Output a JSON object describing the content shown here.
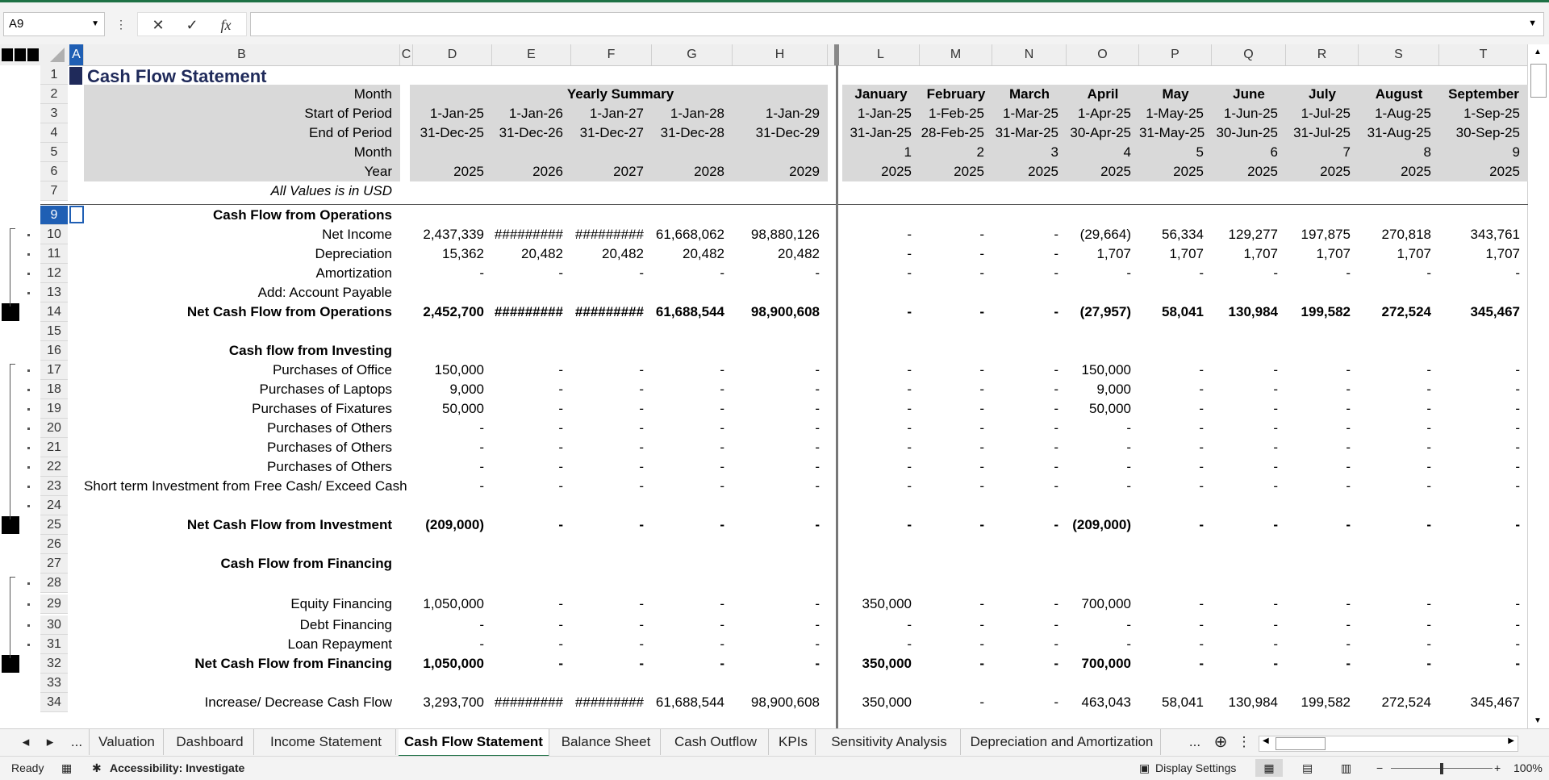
{
  "formula_bar": {
    "name_box": "A9",
    "cancel_icon": "✕",
    "enter_icon": "✓",
    "fx_label": "fx",
    "formula": ""
  },
  "columns": [
    {
      "id": "A",
      "label": "A"
    },
    {
      "id": "B",
      "label": "B"
    },
    {
      "id": "C",
      "label": "C"
    },
    {
      "id": "D",
      "label": "D"
    },
    {
      "id": "E",
      "label": "E"
    },
    {
      "id": "F",
      "label": "F"
    },
    {
      "id": "G",
      "label": "G"
    },
    {
      "id": "H",
      "label": "H"
    },
    {
      "id": "L",
      "label": "L"
    },
    {
      "id": "M",
      "label": "M"
    },
    {
      "id": "N",
      "label": "N"
    },
    {
      "id": "O",
      "label": "O"
    },
    {
      "id": "P",
      "label": "P"
    },
    {
      "id": "Q",
      "label": "Q"
    },
    {
      "id": "R",
      "label": "R"
    },
    {
      "id": "S",
      "label": "S"
    },
    {
      "id": "T",
      "label": "T"
    }
  ],
  "header": {
    "title": "Cash Flow Statement",
    "yearly_summary": "Yearly Summary",
    "all_values": "All Values is in USD",
    "labels": [
      "Month",
      "Start of Period",
      "End of Period",
      "Month",
      "Year"
    ],
    "yearly": {
      "start": [
        "1-Jan-25",
        "1-Jan-26",
        "1-Jan-27",
        "1-Jan-28",
        "1-Jan-29"
      ],
      "end": [
        "31-Dec-25",
        "31-Dec-26",
        "31-Dec-27",
        "31-Dec-28",
        "31-Dec-29"
      ],
      "year": [
        "2025",
        "2026",
        "2027",
        "2028",
        "2029"
      ]
    },
    "monthly": {
      "month": [
        "January",
        "February",
        "March",
        "April",
        "May",
        "June",
        "July",
        "August",
        "September"
      ],
      "start": [
        "1-Jan-25",
        "1-Feb-25",
        "1-Mar-25",
        "1-Apr-25",
        "1-May-25",
        "1-Jun-25",
        "1-Jul-25",
        "1-Aug-25",
        "1-Sep-25"
      ],
      "end": [
        "31-Jan-25",
        "28-Feb-25",
        "31-Mar-25",
        "30-Apr-25",
        "31-May-25",
        "30-Jun-25",
        "31-Jul-25",
        "31-Aug-25",
        "30-Sep-25"
      ],
      "num": [
        "1",
        "2",
        "3",
        "4",
        "5",
        "6",
        "7",
        "8",
        "9"
      ],
      "year": [
        "2025",
        "2025",
        "2025",
        "2025",
        "2025",
        "2025",
        "2025",
        "2025",
        "2025"
      ]
    }
  },
  "body_rows": [
    {
      "n": "9",
      "label": "Cash Flow from Operations",
      "bold": true,
      "yearly": [
        "",
        "",
        "",
        "",
        ""
      ],
      "monthly": [
        "",
        "",
        "",
        "",
        "",
        "",
        "",
        "",
        ""
      ]
    },
    {
      "n": "10",
      "label": "Net Income",
      "bold": false,
      "yearly": [
        "2,437,339",
        "#########",
        "#########",
        "61,668,062",
        "98,880,126"
      ],
      "monthly": [
        "-",
        "-",
        "-",
        "(29,664)",
        "56,334",
        "129,277",
        "197,875",
        "270,818",
        "343,761"
      ]
    },
    {
      "n": "11",
      "label": "Depreciation",
      "bold": false,
      "yearly": [
        "15,362",
        "20,482",
        "20,482",
        "20,482",
        "20,482"
      ],
      "monthly": [
        "-",
        "-",
        "-",
        "1,707",
        "1,707",
        "1,707",
        "1,707",
        "1,707",
        "1,707"
      ]
    },
    {
      "n": "12",
      "label": "Amortization",
      "bold": false,
      "yearly": [
        "-",
        "-",
        "-",
        "-",
        "-"
      ],
      "monthly": [
        "-",
        "-",
        "-",
        "-",
        "-",
        "-",
        "-",
        "-",
        "-"
      ]
    },
    {
      "n": "13",
      "label": "Add: Account Payable",
      "bold": false,
      "yearly": [
        "",
        "",
        "",
        "",
        ""
      ],
      "monthly": [
        "",
        "",
        "",
        "",
        "",
        "",
        "",
        "",
        ""
      ]
    },
    {
      "n": "14",
      "label": "Net Cash Flow from Operations",
      "bold": true,
      "yearly": [
        "2,452,700",
        "#########",
        "#########",
        "61,688,544",
        "98,900,608"
      ],
      "monthly": [
        "-",
        "-",
        "-",
        "(27,957)",
        "58,041",
        "130,984",
        "199,582",
        "272,524",
        "345,467"
      ]
    },
    {
      "n": "15",
      "label": "",
      "bold": false,
      "yearly": [
        "",
        "",
        "",
        "",
        ""
      ],
      "monthly": [
        "",
        "",
        "",
        "",
        "",
        "",
        "",
        "",
        ""
      ]
    },
    {
      "n": "16",
      "label": "Cash flow from Investing",
      "bold": true,
      "yearly": [
        "",
        "",
        "",
        "",
        ""
      ],
      "monthly": [
        "",
        "",
        "",
        "",
        "",
        "",
        "",
        "",
        ""
      ]
    },
    {
      "n": "17",
      "label": "Purchases of Office",
      "bold": false,
      "yearly": [
        "150,000",
        "-",
        "-",
        "-",
        "-"
      ],
      "monthly": [
        "-",
        "-",
        "-",
        "150,000",
        "-",
        "-",
        "-",
        "-",
        "-"
      ]
    },
    {
      "n": "18",
      "label": "Purchases of Laptops",
      "bold": false,
      "yearly": [
        "9,000",
        "-",
        "-",
        "-",
        "-"
      ],
      "monthly": [
        "-",
        "-",
        "-",
        "9,000",
        "-",
        "-",
        "-",
        "-",
        "-"
      ]
    },
    {
      "n": "19",
      "label": "Purchases of Fixatures",
      "bold": false,
      "yearly": [
        "50,000",
        "-",
        "-",
        "-",
        "-"
      ],
      "monthly": [
        "-",
        "-",
        "-",
        "50,000",
        "-",
        "-",
        "-",
        "-",
        "-"
      ]
    },
    {
      "n": "20",
      "label": "Purchases of Others",
      "bold": false,
      "yearly": [
        "-",
        "-",
        "-",
        "-",
        "-"
      ],
      "monthly": [
        "-",
        "-",
        "-",
        "-",
        "-",
        "-",
        "-",
        "-",
        "-"
      ]
    },
    {
      "n": "21",
      "label": "Purchases of Others",
      "bold": false,
      "yearly": [
        "-",
        "-",
        "-",
        "-",
        "-"
      ],
      "monthly": [
        "-",
        "-",
        "-",
        "-",
        "-",
        "-",
        "-",
        "-",
        "-"
      ]
    },
    {
      "n": "22",
      "label": "Purchases of Others",
      "bold": false,
      "yearly": [
        "-",
        "-",
        "-",
        "-",
        "-"
      ],
      "monthly": [
        "-",
        "-",
        "-",
        "-",
        "-",
        "-",
        "-",
        "-",
        "-"
      ]
    },
    {
      "n": "23",
      "label": "Short term Investment from Free Cash/ Exceed Cash",
      "bold": false,
      "yearly": [
        "-",
        "-",
        "-",
        "-",
        "-"
      ],
      "monthly": [
        "-",
        "-",
        "-",
        "-",
        "-",
        "-",
        "-",
        "-",
        "-"
      ]
    },
    {
      "n": "24",
      "label": "",
      "bold": false,
      "yearly": [
        "",
        "",
        "",
        "",
        ""
      ],
      "monthly": [
        "",
        "",
        "",
        "",
        "",
        "",
        "",
        "",
        ""
      ]
    },
    {
      "n": "25",
      "label": "Net Cash Flow from Investment",
      "bold": true,
      "yearly": [
        "(209,000)",
        "-",
        "-",
        "-",
        "-"
      ],
      "monthly": [
        "-",
        "-",
        "-",
        "(209,000)",
        "-",
        "-",
        "-",
        "-",
        "-"
      ]
    },
    {
      "n": "26",
      "label": "",
      "bold": false,
      "yearly": [
        "",
        "",
        "",
        "",
        ""
      ],
      "monthly": [
        "",
        "",
        "",
        "",
        "",
        "",
        "",
        "",
        ""
      ]
    },
    {
      "n": "27",
      "label": "Cash Flow from Financing",
      "bold": true,
      "yearly": [
        "",
        "",
        "",
        "",
        ""
      ],
      "monthly": [
        "",
        "",
        "",
        "",
        "",
        "",
        "",
        "",
        ""
      ]
    },
    {
      "n": "28",
      "label": "",
      "bold": false,
      "yearly": [
        "",
        "",
        "",
        "",
        ""
      ],
      "monthly": [
        "",
        "",
        "",
        "",
        "",
        "",
        "",
        "",
        ""
      ]
    },
    {
      "n": "29",
      "label": "Equity Financing",
      "bold": false,
      "yearly": [
        "1,050,000",
        "-",
        "-",
        "-",
        "-"
      ],
      "monthly": [
        "350,000",
        "-",
        "-",
        "700,000",
        "-",
        "-",
        "-",
        "-",
        "-"
      ]
    },
    {
      "n": "30",
      "label": "Debt Financing",
      "bold": false,
      "yearly": [
        "-",
        "-",
        "-",
        "-",
        "-"
      ],
      "monthly": [
        "-",
        "-",
        "-",
        "-",
        "-",
        "-",
        "-",
        "-",
        "-"
      ]
    },
    {
      "n": "31",
      "label": "Loan Repayment",
      "bold": false,
      "yearly": [
        "-",
        "-",
        "-",
        "-",
        "-"
      ],
      "monthly": [
        "-",
        "-",
        "-",
        "-",
        "-",
        "-",
        "-",
        "-",
        "-"
      ]
    },
    {
      "n": "32",
      "label": "Net Cash Flow from Financing",
      "bold": true,
      "yearly": [
        "1,050,000",
        "-",
        "-",
        "-",
        "-"
      ],
      "monthly": [
        "350,000",
        "-",
        "-",
        "700,000",
        "-",
        "-",
        "-",
        "-",
        "-"
      ]
    },
    {
      "n": "33",
      "label": "",
      "bold": false,
      "yearly": [
        "",
        "",
        "",
        "",
        ""
      ],
      "monthly": [
        "",
        "",
        "",
        "",
        "",
        "",
        "",
        "",
        ""
      ]
    },
    {
      "n": "34",
      "label": "Increase/ Decrease Cash Flow",
      "bold": false,
      "yearly": [
        "3,293,700",
        "#########",
        "#########",
        "61,688,544",
        "98,900,608"
      ],
      "monthly": [
        "350,000",
        "-",
        "-",
        "463,043",
        "58,041",
        "130,984",
        "199,582",
        "272,524",
        "345,467"
      ]
    }
  ],
  "sheet_tabs": [
    "Valuation",
    "Dashboard",
    "Income Statement",
    "Cash Flow Statement",
    "Balance Sheet",
    "Cash Outflow",
    "KPIs",
    "Sensitivity Analysis",
    "Depreciation and Amortization"
  ],
  "active_tab": "Cash Flow Statement",
  "tab_nav": {
    "prev": "◂",
    "next": "▸",
    "more_left": "...",
    "more_right": "..."
  },
  "status_bar": {
    "ready": "Ready",
    "accessibility": "Accessibility: Investigate",
    "display_settings": "Display Settings",
    "zoom": "100%",
    "zoom_level": 0.5
  }
}
